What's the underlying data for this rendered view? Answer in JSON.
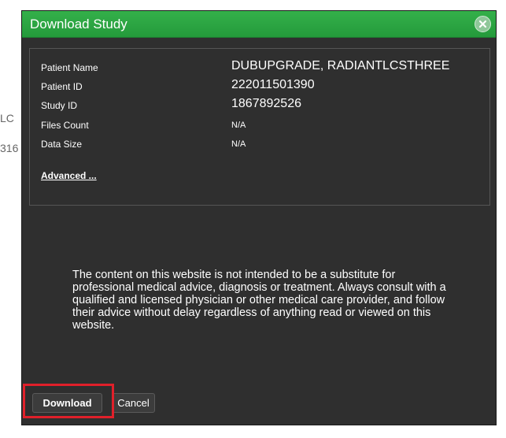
{
  "background": {
    "fragment_1": "LC",
    "fragment_2": "316"
  },
  "dialog": {
    "title": "Download Study",
    "close_icon": "close-circle-icon",
    "fields": {
      "patient_name_label": "Patient Name",
      "patient_name_value": "DUBUPGRADE, RADIANTLCSTHREE",
      "patient_id_label": "Patient ID",
      "patient_id_value": "222011501390",
      "study_id_label": "Study ID",
      "study_id_value": "1867892526",
      "files_count_label": "Files Count",
      "files_count_value": "N/A",
      "data_size_label": "Data Size",
      "data_size_value": "N/A"
    },
    "advanced_link": "Advanced ...",
    "disclaimer": "The content on this website is not intended to be a substitute for professional medical advice, diagnosis or treatment. Always consult with a qualified and licensed physician or other medical care provider, and follow their advice without delay regardless of anything read or viewed on this website.",
    "buttons": {
      "download": "Download",
      "cancel": "Cancel"
    }
  },
  "colors": {
    "titlebar": "#2ea043",
    "dialog_bg": "#2f2f2f",
    "highlight": "#e0202a"
  }
}
